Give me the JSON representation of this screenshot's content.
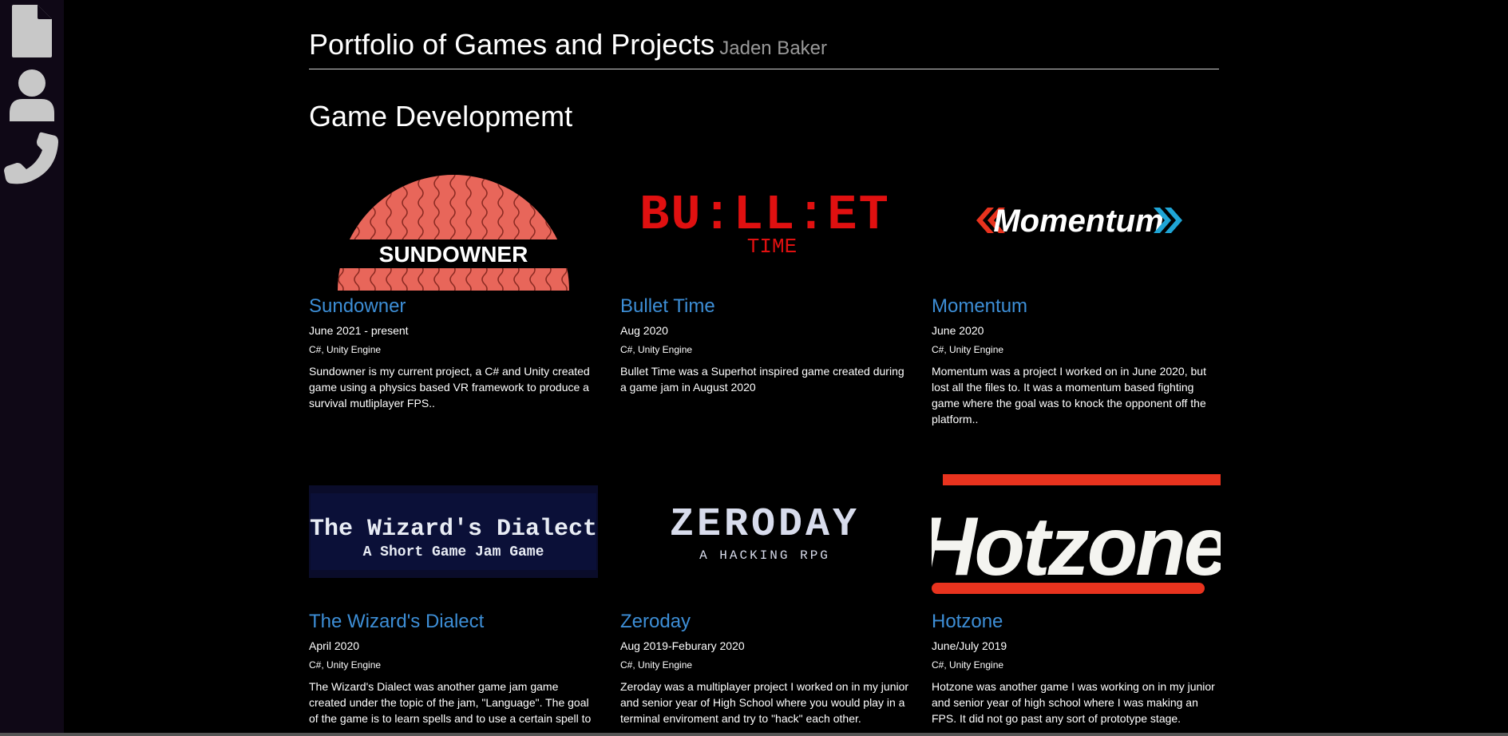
{
  "nav": {
    "icons": [
      "document-icon",
      "person-icon",
      "phone-icon"
    ]
  },
  "header": {
    "title": "Portfolio of Games and Projects",
    "subtitle": "Jaden Baker"
  },
  "section": {
    "title": "Game Developmemt"
  },
  "projects": [
    {
      "logo_text": "SUNDOWNER",
      "title": "Sundowner",
      "date": "June 2021 - present",
      "tech": "C#, Unity Engine",
      "description": "Sundowner is my current project, a C# and Unity created game using a physics based VR framework to produce a survival mutliplayer FPS.."
    },
    {
      "logo_text": "BU:LL:ET",
      "logo_sub": "TIME",
      "title": "Bullet Time",
      "date": "Aug 2020",
      "tech": "C#, Unity Engine",
      "description": "Bullet Time was a Superhot inspired game created during a game jam in August 2020"
    },
    {
      "logo_text": "Momentum",
      "title": "Momentum",
      "date": "June 2020",
      "tech": "C#, Unity Engine",
      "description": "Momentum was a project I worked on in June 2020, but lost all the files to. It was a momentum based fighting game where the goal was to knock the opponent off the platform.."
    },
    {
      "logo_text": "The Wizard's Dialect",
      "logo_sub": "A Short Game Jam Game",
      "title": "The Wizard's Dialect",
      "date": "April 2020",
      "tech": "C#, Unity Engine",
      "description": "The Wizard's Dialect was another game jam game created under the topic of the jam, \"Language\". The goal of the game is to learn spells and to use a certain spell to"
    },
    {
      "logo_text": "ZERODAY",
      "logo_sub": "A HACKING RPG",
      "title": "Zeroday",
      "date": "Aug 2019-Feburary 2020",
      "tech": "C#, Unity Engine",
      "description": "Zeroday was a multiplayer project I worked on in my junior and senior year of High School where you would play in a terminal enviroment and try to \"hack\" each other."
    },
    {
      "logo_text": "Hotzone",
      "title": "Hotzone",
      "date": "June/July 2019",
      "tech": "C#, Unity Engine",
      "description": "Hotzone was another game I was working on in my junior and senior year of high school where I was making an FPS. It did not go past any sort of prototype stage."
    }
  ]
}
